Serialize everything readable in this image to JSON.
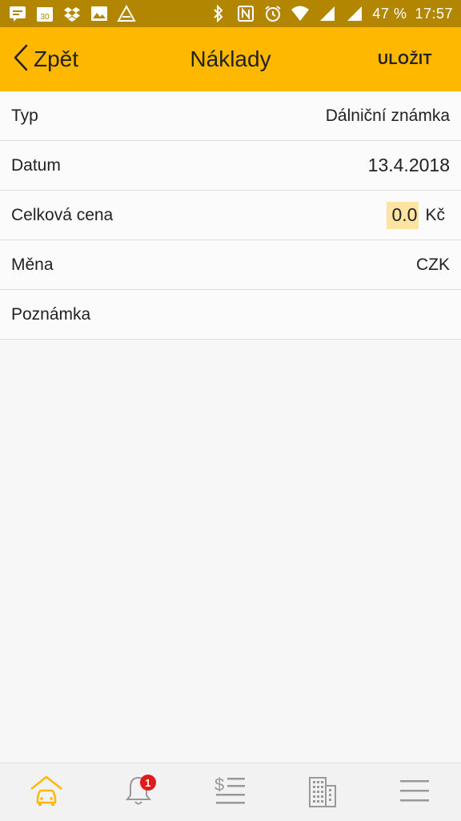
{
  "status_bar": {
    "battery": "47 %",
    "time": "17:57",
    "calendar_day": "30",
    "icons": [
      "message-icon",
      "calendar-icon",
      "dropbox-icon",
      "image-icon",
      "notification-icon",
      "bluetooth-icon",
      "nfc-icon",
      "alarm-icon",
      "wifi-icon",
      "signal-icon",
      "signal-icon"
    ]
  },
  "header": {
    "back_label": "Zpět",
    "title": "Náklady",
    "save_label": "ULOŽIT"
  },
  "form": {
    "type": {
      "label": "Typ",
      "value": "Dálniční známka"
    },
    "date": {
      "label": "Datum",
      "value": "13.4.2018"
    },
    "total": {
      "label": "Celková cena",
      "value": "0.0",
      "unit": "Kč"
    },
    "currency": {
      "label": "Měna",
      "value": "CZK"
    },
    "note": {
      "label": "Poznámka",
      "value": ""
    }
  },
  "bottom_nav": {
    "items": [
      "car-home-icon",
      "bell-icon",
      "costs-list-icon",
      "building-icon",
      "menu-icon"
    ],
    "notification_count": "1",
    "active_color": "#ffb800"
  },
  "colors": {
    "accent": "#ffb800",
    "status_bar": "#b38600",
    "highlight": "#ffe3a3",
    "badge": "#e11b1b"
  }
}
